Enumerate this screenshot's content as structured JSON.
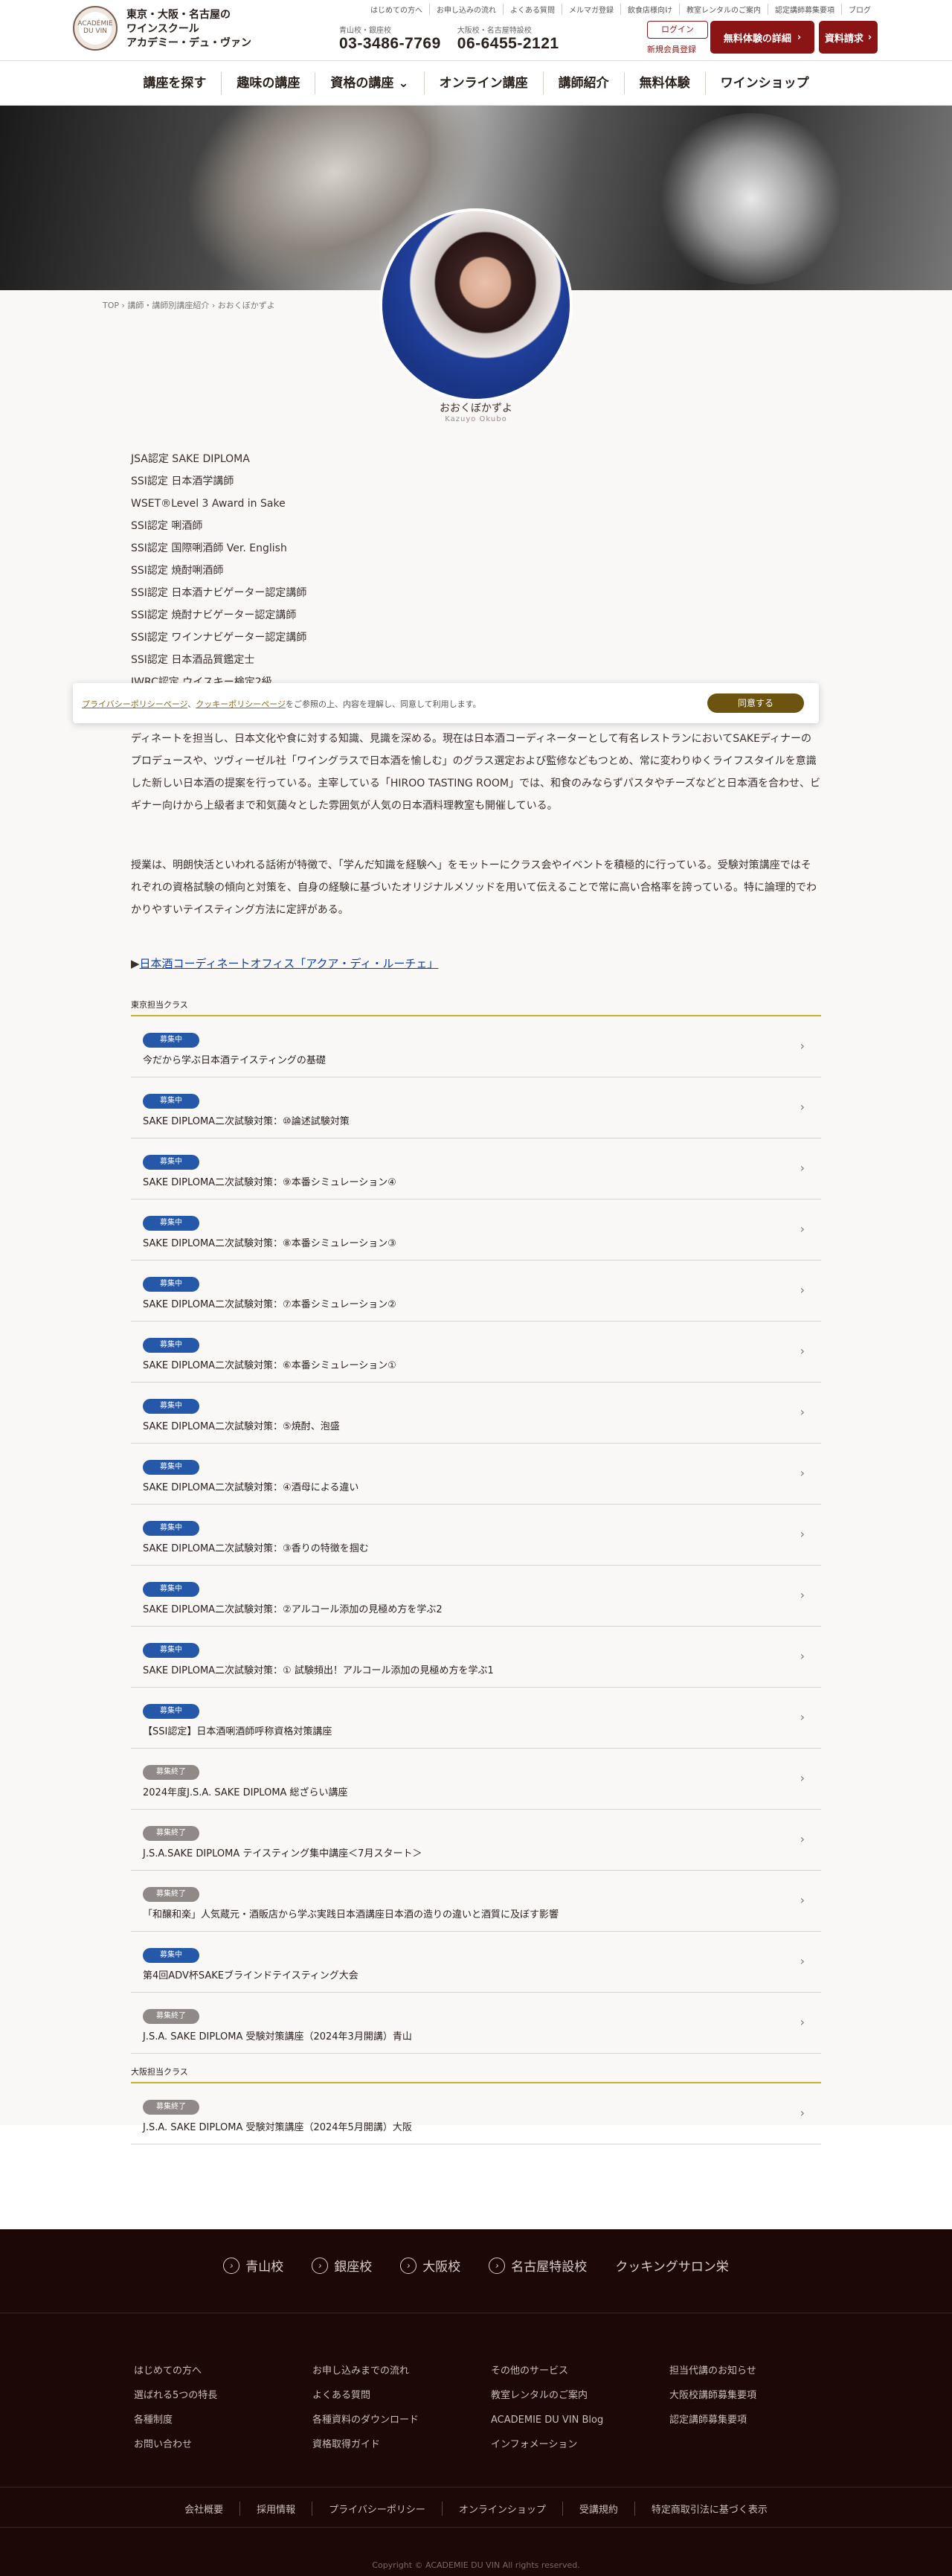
{
  "header": {
    "logo_text": "ACADÉMIE DU VIN",
    "school_lines": [
      "東京・大阪・名古屋の",
      "ワインスクール",
      "アカデミー・デュ・ヴァン"
    ],
    "top_links": [
      "はじめての方へ",
      "お申し込みの流れ",
      "よくある質問",
      "メルマガ登録",
      "飲食店様向け",
      "教室レンタルのご案内",
      "認定講師募集要項",
      "ブログ"
    ],
    "phone1_label": "青山校・銀座校",
    "phone1": "03-3486-7769",
    "phone2_label": "大阪校・名古屋特設校",
    "phone2": "06-6455-2121",
    "login": "ログイン",
    "new_member": "新規会員登録",
    "cta_trial": "無料体験の詳細",
    "cta_docs": "資料請求"
  },
  "nav": [
    "講座を探す",
    "趣味の講座",
    "資格の講座",
    "オンライン講座",
    "講師紹介",
    "無料体験",
    "ワインショップ"
  ],
  "breadcrumb": "TOP › 講師・講師別講座紹介 › おおくぼかずよ",
  "profile": {
    "name": "おおくぼかずよ",
    "roman": "Kazuyo Okubo",
    "qualifications": [
      "JSA認定 SAKE DIPLOMA",
      "SSI認定 日本酒学講師",
      "WSET®Level 3 Award in Sake",
      "SSI認定 唎酒師",
      "SSI認定 国際唎酒師 Ver. English",
      "SSI認定 焼酎唎酒師",
      "SSI認定 日本酒ナビゲーター認定講師",
      "SSI認定 焼酎ナビゲーター認定講師",
      "SSI認定 ワインナビゲーター認定講師",
      "SSI認定 日本酒品質鑑定士",
      "JWRC認定 ウイスキー検定2級"
    ],
    "bio1": "ディネートを担当し、日本文化や食に対する知識、見識を深める。現在は日本酒コーディネーターとして有名レストランにおいてSAKEディナーのプロデュースや、ツヴィーゼル社「ワイングラスで日本酒を愉しむ」のグラス選定および監修などもつとめ、常に変わりゆくライフスタイルを意識した新しい日本酒の提案を行っている。主宰している「HIROO TASTING ROOM」では、和食のみならずパスタやチーズなどと日本酒を合わせ、ビギナー向けから上級者まで和気藹々とした雰囲気が人気の日本酒料理教室も開催している。",
    "bio2": "授業は、明朗快活といわれる話術が特徴で、「学んだ知識を経験へ」をモットーにクラス会やイベントを積極的に行っている。受験対策講座ではそれぞれの資格試験の傾向と対策を、自身の経験に基づいたオリジナルメソッドを用いて伝えることで常に高い合格率を誇っている。特に論理的でわかりやすいテイスティング方法に定評がある。",
    "office_prefix": "▶",
    "office_link": "日本酒コーディネートオフィス「アクア・ディ・ルーチェ」"
  },
  "cookie": {
    "privacy": "プライバシーポリシーページ",
    "sep": "、",
    "cookie_policy": "クッキーポリシーページ",
    "text": "をご参照の上、内容を理解し、同意して利用します。",
    "agree": "同意する"
  },
  "tokyo": {
    "heading": "東京担当クラス",
    "items": [
      {
        "status": "募集中",
        "title": "今だから学ぶ日本酒テイスティングの基礎"
      },
      {
        "status": "募集中",
        "title": "SAKE DIPLOMA二次試験対策：⑩論述試験対策"
      },
      {
        "status": "募集中",
        "title": "SAKE DIPLOMA二次試験対策：⑨本番シミュレーション④"
      },
      {
        "status": "募集中",
        "title": "SAKE DIPLOMA二次試験対策：⑧本番シミュレーション③"
      },
      {
        "status": "募集中",
        "title": "SAKE DIPLOMA二次試験対策：⑦本番シミュレーション②"
      },
      {
        "status": "募集中",
        "title": "SAKE DIPLOMA二次試験対策：⑥本番シミュレーション①"
      },
      {
        "status": "募集中",
        "title": "SAKE DIPLOMA二次試験対策：⑤焼酎、泡盛"
      },
      {
        "status": "募集中",
        "title": "SAKE DIPLOMA二次試験対策：④酒母による違い"
      },
      {
        "status": "募集中",
        "title": "SAKE DIPLOMA二次試験対策：③香りの特徴を掴む"
      },
      {
        "status": "募集中",
        "title": "SAKE DIPLOMA二次試験対策：②アルコール添加の見極め方を学ぶ2"
      },
      {
        "status": "募集中",
        "title": "SAKE DIPLOMA二次試験対策：① 試験頻出！アルコール添加の見極め方を学ぶ1"
      },
      {
        "status": "募集中",
        "title": "【SSI認定】日本酒唎酒師呼称資格対策講座"
      },
      {
        "status": "募集終了",
        "title": "2024年度J.S.A. SAKE DIPLOMA 総ざらい講座"
      },
      {
        "status": "募集終了",
        "title": "J.S.A.SAKE DIPLOMA テイスティング集中講座＜7月スタート＞"
      },
      {
        "status": "募集終了",
        "title": "「和醸和楽」人気蔵元・酒販店から学ぶ実践日本酒講座日本酒の造りの違いと酒質に及ぼす影響"
      },
      {
        "status": "募集中",
        "title": "第4回ADV杯SAKEブラインドテイスティング大会"
      },
      {
        "status": "募集終了",
        "title": "J.S.A. SAKE DIPLOMA 受験対策講座（2024年3月開講）青山"
      }
    ]
  },
  "osaka": {
    "heading": "大阪担当クラス",
    "items": [
      {
        "status": "募集終了",
        "title": "J.S.A. SAKE DIPLOMA 受験対策講座（2024年5月開講）大阪"
      }
    ]
  },
  "footer": {
    "schools": [
      "青山校",
      "銀座校",
      "大阪校",
      "名古屋特設校"
    ],
    "salon": "クッキングサロン栄",
    "col1": [
      "はじめての方へ",
      "選ばれる5つの特長",
      "各種制度",
      "お問い合わせ"
    ],
    "col2": [
      "お申し込みまでの流れ",
      "よくある質問",
      "各種資料のダウンロード",
      "資格取得ガイド"
    ],
    "col3": [
      "その他のサービス",
      "教室レンタルのご案内",
      "ACADEMIE DU VIN Blog",
      "インフォメーション"
    ],
    "col4": [
      "担当代講のお知らせ",
      "大阪校講師募集要項",
      "認定講師募集要項"
    ],
    "bottom": [
      "会社概要",
      "採用情報",
      "プライバシーポリシー",
      "オンラインショップ",
      "受講規約",
      "特定商取引法に基づく表示"
    ],
    "copyright": "Copyright © ACADEMIE DU VIN All rights reserved."
  }
}
